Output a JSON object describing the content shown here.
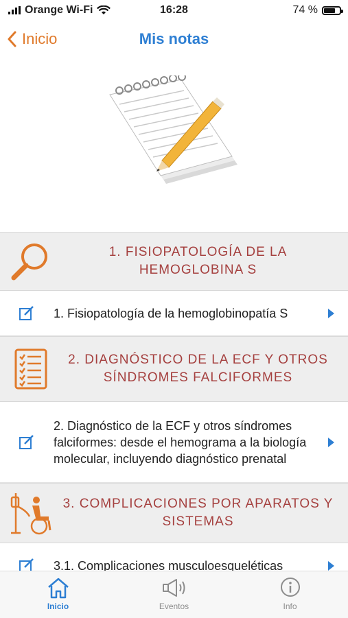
{
  "status_bar": {
    "carrier": "Orange Wi-Fi",
    "time": "16:28",
    "battery_label": "74 %",
    "battery_level": 0.74
  },
  "nav": {
    "back_label": "Inicio",
    "title": "Mis notas"
  },
  "sections": [
    {
      "title": "1. FISIOPATOLOGÍA DE LA HEMOGLOBINA S",
      "icon": "magnifier-icon",
      "items": [
        {
          "text": "1. Fisiopatología de la hemoglobinopatía S"
        }
      ]
    },
    {
      "title": "2. DIAGNÓSTICO DE LA ECF Y OTROS SÍNDROMES FALCIFORMES",
      "icon": "checklist-icon",
      "items": [
        {
          "text": "2. Diagnóstico de la ECF y otros síndromes falciformes: desde el hemograma a la biología molecular, incluyendo diagnóstico prenatal"
        }
      ]
    },
    {
      "title": "3. COMPLICACIONES POR APARATOS Y SISTEMAS",
      "icon": "wheelchair-iv-icon",
      "items": [
        {
          "text": "3.1. Complicaciones musculoesqueléticas"
        }
      ]
    }
  ],
  "tabs": [
    {
      "label": "Inicio",
      "icon": "home-icon",
      "active": true
    },
    {
      "label": "Eventos",
      "icon": "megaphone-icon",
      "active": false
    },
    {
      "label": "Info",
      "icon": "info-icon",
      "active": false
    }
  ],
  "colors": {
    "accent_orange": "#e07a2b",
    "accent_blue": "#2e7fd3",
    "section_title": "#a5403f",
    "section_bg": "#eeeeee"
  }
}
